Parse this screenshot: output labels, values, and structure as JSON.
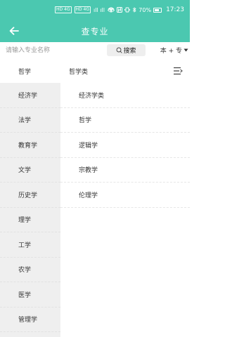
{
  "status_bar": {
    "network_chips": [
      "HD 4G",
      "HD 4G"
    ],
    "signal_text": "ıll ıll",
    "battery_percent": "70%",
    "time": "17:23"
  },
  "header": {
    "title": "查专业",
    "background_color": "#4bc8b0"
  },
  "search": {
    "placeholder": "请输入专业名称",
    "button_label": "搜索",
    "level_select": "本 + 专"
  },
  "breadcrumb": {
    "category": "哲学",
    "subcategory": "哲学类"
  },
  "sidebar": {
    "items": [
      {
        "label": "经济学"
      },
      {
        "label": "法学"
      },
      {
        "label": "教育学"
      },
      {
        "label": "文学"
      },
      {
        "label": "历史学"
      },
      {
        "label": "理学"
      },
      {
        "label": "工学"
      },
      {
        "label": "农学"
      },
      {
        "label": "医学"
      },
      {
        "label": "管理学"
      }
    ]
  },
  "content": {
    "items": [
      {
        "label": "经济学类"
      },
      {
        "label": "哲学"
      },
      {
        "label": "逻辑学"
      },
      {
        "label": "宗教学"
      },
      {
        "label": "伦理学"
      }
    ]
  }
}
